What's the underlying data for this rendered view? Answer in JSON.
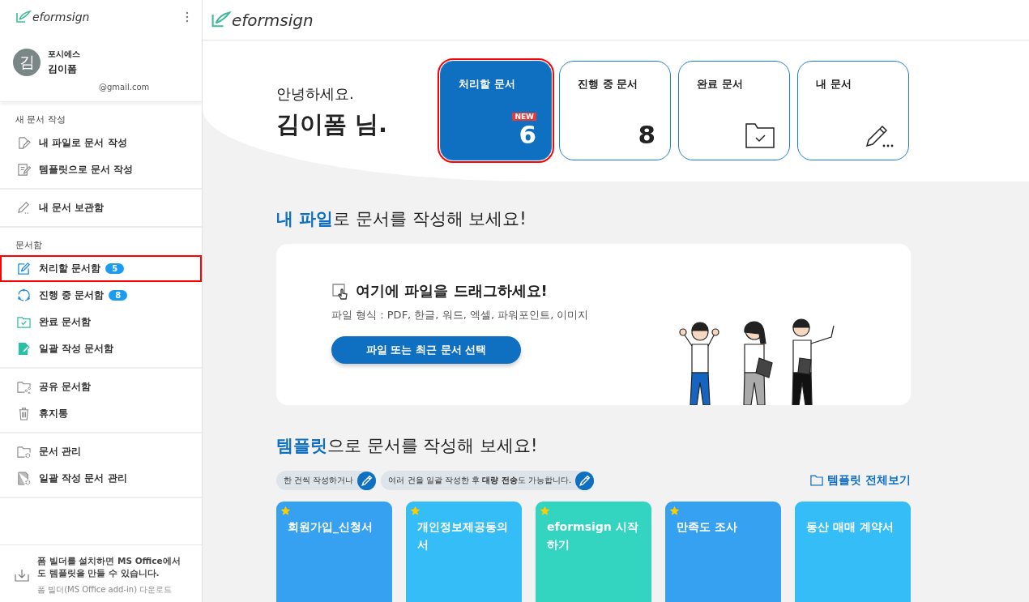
{
  "sidebar": {
    "logo": "eformsign",
    "profile": {
      "avatar": "김",
      "company": "포시에스",
      "name": "김이폼",
      "email": "@gmail.com"
    },
    "sections": [
      {
        "title": "새 문서 작성",
        "items": [
          {
            "kind": "file-pen",
            "label": "내 파일로 문서 작성",
            "highlighted": false
          },
          {
            "kind": "template-pen",
            "label": "템플릿으로 문서 작성",
            "highlighted": false
          }
        ]
      },
      {
        "items": [
          {
            "kind": "pencil",
            "label": "내 문서 보관함",
            "highlighted": false
          }
        ]
      },
      {
        "title": "문서함",
        "items": [
          {
            "kind": "edit",
            "label": "처리할 문서함",
            "badge": "5",
            "highlighted": true
          },
          {
            "kind": "cycle",
            "label": "진행 중 문서함",
            "badge": "8",
            "highlighted": false
          },
          {
            "kind": "folder-check",
            "label": "완료 문서함",
            "highlighted": false
          },
          {
            "kind": "bulk",
            "label": "일괄 작성 문서함",
            "highlighted": false
          }
        ]
      },
      {
        "items": [
          {
            "kind": "share",
            "label": "공유 문서함",
            "highlighted": false
          },
          {
            "kind": "trash",
            "label": "휴지통",
            "highlighted": false
          }
        ]
      },
      {
        "items": [
          {
            "kind": "folder-gear",
            "label": "문서 관리",
            "highlighted": false
          },
          {
            "kind": "bulk-gear",
            "label": "일괄 작성 문서 관리",
            "highlighted": false
          }
        ]
      }
    ],
    "footer": {
      "text": "폼 빌더를 설치하면 MS Office에서도 템플릿을 만들 수 있습니다.",
      "link": "폼 빌더(MS Office add-in) 다운로드"
    }
  },
  "header": {
    "logo": "eformsign"
  },
  "hero": {
    "greeting": "안녕하세요.",
    "name": "김이폼 님.",
    "cards": [
      {
        "kind": "count",
        "title": "처리할 문서",
        "badge": "NEW",
        "value": "6",
        "selected": true,
        "highlighted": true
      },
      {
        "kind": "count",
        "title": "진행 중 문서",
        "value": "8",
        "selected": false,
        "highlighted": false
      },
      {
        "kind": "folder",
        "title": "완료 문서",
        "selected": false,
        "highlighted": false
      },
      {
        "kind": "pencil",
        "title": "내 문서",
        "selected": false,
        "highlighted": false
      }
    ]
  },
  "upload": {
    "heading": "**내 파일**로 문서를 작성해 보세요!",
    "drop_title": "여기에 파일을 드래그하세요!",
    "formats": "파일 형식 : PDF, 한글, 워드, 엑셀, 파워포인트, 이미지",
    "button": "파일 또는 최근 문서 선택"
  },
  "templates": {
    "heading": "**템플릿**으로 문서를 작성해 보세요!",
    "hints": [
      "한 건씩 작성하거나",
      "여러 건을 일괄 작성한 후 **대량 전송**도 가능합니다."
    ],
    "view_all": "템플릿 전체보기",
    "cards": [
      {
        "title": "회원가입_신청서",
        "starred": true,
        "color": "#36a1f0"
      },
      {
        "title": "개인정보제공동의서",
        "starred": true,
        "color": "#35bdf7"
      },
      {
        "title": "eformsign 시작하기",
        "starred": true,
        "color": "#33d4c0"
      },
      {
        "title": "만족도 조사",
        "starred": true,
        "color": "#36a1f0"
      },
      {
        "title": "동산 매매 계약서",
        "starred": false,
        "color": "#35bdf7"
      }
    ]
  }
}
